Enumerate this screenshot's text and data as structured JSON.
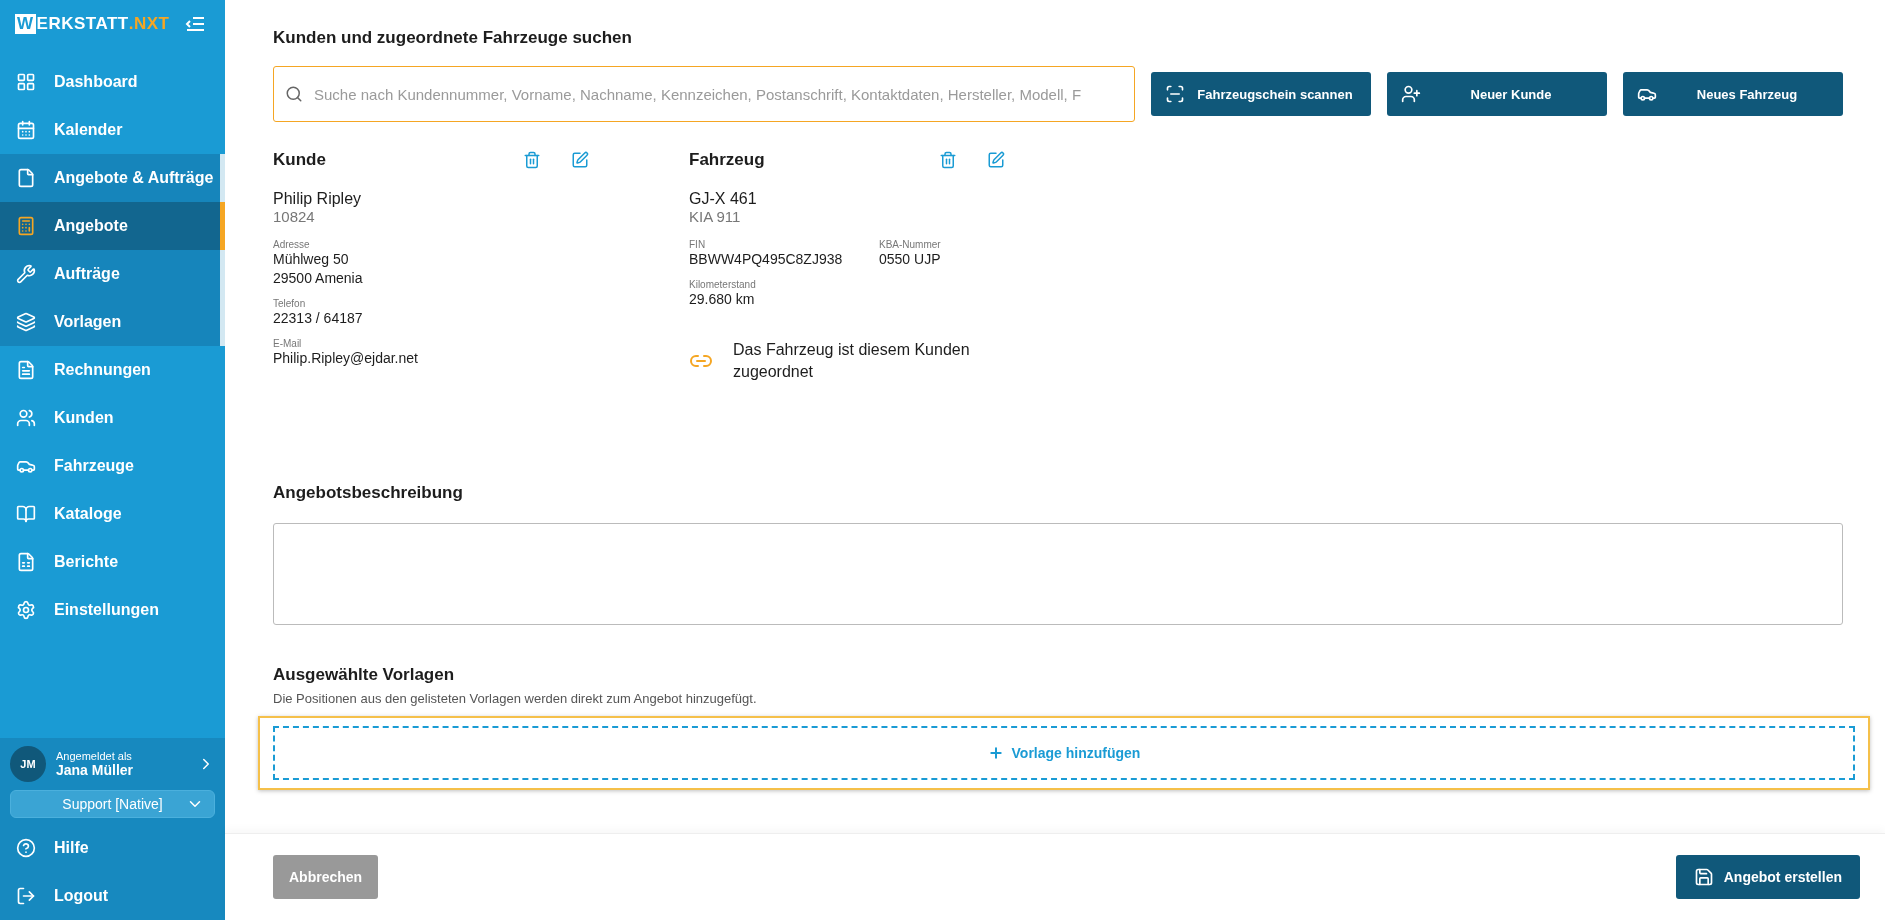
{
  "logo": {
    "boxed": "W",
    "main": "ERKSTATT",
    "accent": ".NXT"
  },
  "nav": [
    {
      "label": "Dashboard",
      "selected": false
    },
    {
      "label": "Kalender",
      "selected": false
    },
    {
      "label": "Angebote & Aufträge",
      "selected": false,
      "expanded": true,
      "children": [
        {
          "label": "Angebote",
          "selected": true
        },
        {
          "label": "Aufträge",
          "selected": false
        },
        {
          "label": "Vorlagen",
          "selected": false
        }
      ]
    },
    {
      "label": "Rechnungen",
      "selected": false
    },
    {
      "label": "Kunden",
      "selected": false
    },
    {
      "label": "Fahrzeuge",
      "selected": false
    },
    {
      "label": "Kataloge",
      "selected": false
    },
    {
      "label": "Berichte",
      "selected": false
    },
    {
      "label": "Einstellungen",
      "selected": false
    }
  ],
  "user": {
    "initials": "JM",
    "caption": "Angemeldet als",
    "name": "Jana Müller",
    "role": "Support [Native]"
  },
  "footer_nav": [
    {
      "label": "Hilfe"
    },
    {
      "label": "Logout"
    }
  ],
  "search_section": {
    "title": "Kunden und zugeordnete Fahrzeuge suchen",
    "placeholder": "Suche nach Kundennummer, Vorname, Nachname, Kennzeichen, Postanschrift, Kontaktdaten, Hersteller, Modell, F",
    "buttons": [
      "Fahrzeugschein scannen",
      "Neuer Kunde",
      "Neues Fahrzeug"
    ]
  },
  "customer": {
    "title": "Kunde",
    "name": "Philip Ripley",
    "number": "10824",
    "fields": [
      {
        "label": "Adresse",
        "lines": [
          "Mühlweg 50",
          "29500 Amenia"
        ]
      },
      {
        "label": "Telefon",
        "lines": [
          "22313 / 64187"
        ]
      },
      {
        "label": "E-Mail",
        "lines": [
          "Philip.Ripley@ejdar.net"
        ]
      }
    ]
  },
  "vehicle": {
    "title": "Fahrzeug",
    "plate": "GJ-X 461",
    "model": "KIA 911",
    "fields": [
      {
        "label": "FIN",
        "value": "BBWW4PQ495C8ZJ938"
      },
      {
        "label": "KBA-Nummer",
        "value": "0550 UJP"
      },
      {
        "label": "Kilometerstand",
        "value": "29.680 km"
      }
    ],
    "linked": true,
    "link_note": "Das Fahrzeug ist diesem Kunden zugeordnet"
  },
  "description": {
    "title": "Angebotsbeschreibung"
  },
  "templates": {
    "title": "Ausgewählte Vorlagen",
    "hint": "Die Positionen aus den gelisteten Vorlagen werden direkt zum Angebot hinzugefügt.",
    "add_label": "Vorlage hinzufügen",
    "focused": true
  },
  "actions": {
    "cancel": "Abbrechen",
    "submit": "Angebot erstellen"
  }
}
